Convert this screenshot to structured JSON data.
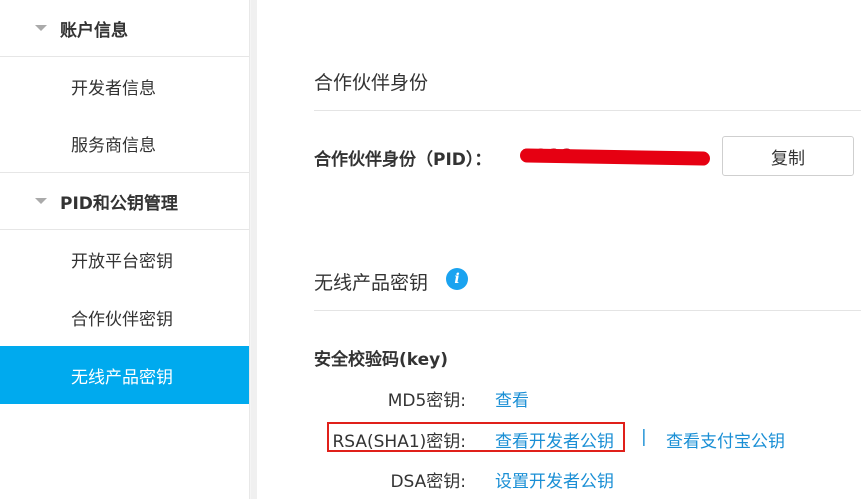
{
  "sidebar": {
    "groups": [
      {
        "label": "账户信息",
        "items": [
          "开发者信息",
          "服务商信息"
        ]
      },
      {
        "label": "PID和公钥管理",
        "items": [
          "开放平台密钥",
          "合作伙伴密钥",
          "无线产品密钥"
        ]
      }
    ],
    "active_item": "无线产品密钥"
  },
  "main": {
    "partner_section_title": "合作伙伴身份",
    "pid_label": "合作伙伴身份（PID）：",
    "pid_value": "2088……",
    "copy_button": "复制",
    "wireless_section_title": "无线产品密钥",
    "info_icon": "i",
    "key_title": "安全校验码(key)",
    "rows": [
      {
        "label": "MD5密钥:",
        "link": "查看"
      },
      {
        "label": "RSA(SHA1)密钥:",
        "link": "查看开发者公钥",
        "separator": "|",
        "link2": "查看支付宝公钥"
      },
      {
        "label": "DSA密钥:",
        "link": "设置开发者公钥"
      }
    ]
  },
  "colors": {
    "accent": "#00aaee",
    "link": "#1a8fd5",
    "highlight_border": "#e0201a"
  }
}
